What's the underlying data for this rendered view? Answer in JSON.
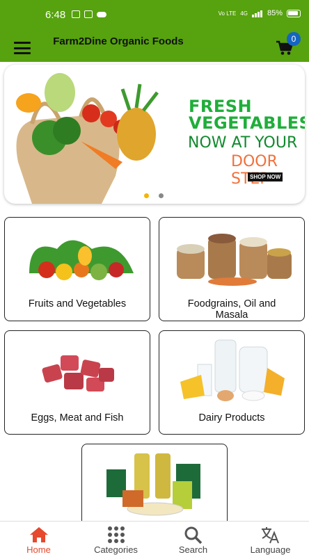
{
  "status_bar": {
    "time": "6:48",
    "network_label": "Vo LTE",
    "network_type": "4G",
    "battery": "85%"
  },
  "app_bar": {
    "title": "Farm2Dine Organic Foods",
    "cart_count": "0",
    "accent_color": "#57a20f"
  },
  "banner": {
    "line1": "FRESH",
    "line2": "VEGETABLES",
    "line3": "NOW AT YOUR",
    "line4": "DOOR STEP",
    "cta": "SHOP NOW",
    "active_slide": 1,
    "slide_count": 2
  },
  "categories": [
    {
      "label": "Fruits and Vegetables"
    },
    {
      "label": "Foodgrains, Oil and Masala"
    },
    {
      "label": "Eggs, Meat and Fish"
    },
    {
      "label": "Dairy Products"
    },
    {
      "label": ""
    }
  ],
  "bottom_nav": [
    {
      "label": "Home",
      "icon": "home-icon",
      "active": true
    },
    {
      "label": "Categories",
      "icon": "grid-icon",
      "active": false
    },
    {
      "label": "Search",
      "icon": "search-icon",
      "active": false
    },
    {
      "label": "Language",
      "icon": "translate-icon",
      "active": false
    }
  ]
}
